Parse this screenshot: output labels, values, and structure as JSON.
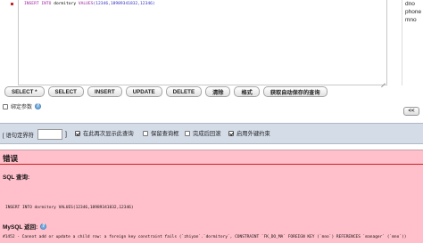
{
  "editor": {
    "sql_keywords": "INSERT INTO",
    "sql_table": " dormitory ",
    "sql_values_kw": "VALUES",
    "sql_values": "(12346,18989341832,12346)"
  },
  "columns_panel": {
    "items": [
      "dno",
      "phone",
      "mno"
    ]
  },
  "toolbar": {
    "buttons": [
      {
        "label": "SELECT *"
      },
      {
        "label": "SELECT"
      },
      {
        "label": "INSERT"
      },
      {
        "label": "UPDATE"
      },
      {
        "label": "DELETE"
      },
      {
        "label": "清除"
      },
      {
        "label": "格式"
      },
      {
        "label": "获取自动保存的查询"
      }
    ]
  },
  "bind_params": {
    "label": "绑定参数"
  },
  "collapse": {
    "label": "<<"
  },
  "options": {
    "delimiter_label": "[ 语句定界符",
    "delimiter_value": "",
    "delimiter_close": "]",
    "show_again_label": "在此再次显示此查询",
    "retain_box_label": "保留查询框",
    "rollback_label": "完成后回滚",
    "fk_label": "启用外键约束"
  },
  "error": {
    "title": "错误",
    "sql_query_label": "SQL 查询:",
    "sql_text": "INSERT INTO dormitory VALUES(12346,18989341832,12346)",
    "mysql_label": "MySQL 返回:",
    "mysql_message": "#1452 - Cannot add or update a child row: a foreign key constraint fails (`zhiyan`.`dormitory`, CONSTRAINT `FK_DO_MA` FOREIGN KEY (`mno`) REFERENCES `manager` (`mno`))"
  }
}
